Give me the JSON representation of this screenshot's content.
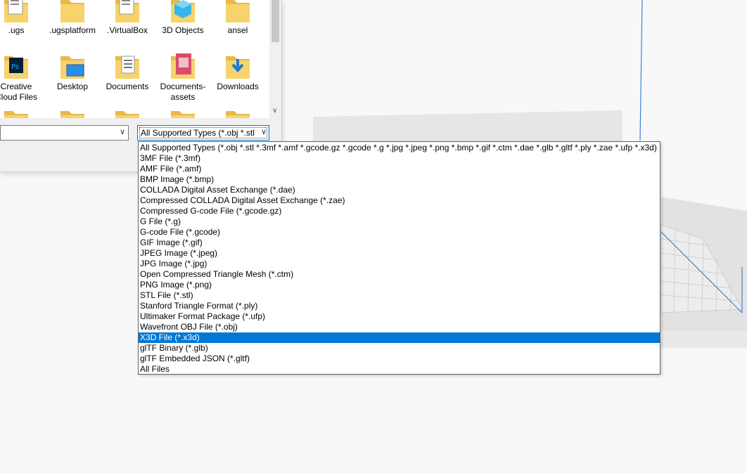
{
  "dialog": {
    "files": [
      {
        "name": ".ugs",
        "icon": "document-folder-icon"
      },
      {
        "name": ".ugsplatform",
        "icon": "folder-icon"
      },
      {
        "name": ".VirtualBox",
        "icon": "document-folder-icon"
      },
      {
        "name": "3D Objects",
        "icon": "3d-objects-folder-icon"
      },
      {
        "name": "ansel",
        "icon": "folder-icon"
      },
      {
        "name": "Creative Cloud Files",
        "icon": "creative-cloud-folder-icon"
      },
      {
        "name": "Desktop",
        "icon": "desktop-folder-icon"
      },
      {
        "name": "Documents",
        "icon": "documents-folder-icon"
      },
      {
        "name": "Documents-assets",
        "icon": "image-folder-icon"
      },
      {
        "name": "Downloads",
        "icon": "downloads-folder-icon"
      }
    ],
    "file_name_value": "",
    "file_type_selected": "All Supported Types (*.obj *.stl *",
    "file_type_options": [
      "All Supported Types (*.obj *.stl *.3mf *.amf *.gcode.gz *.gcode *.g *.jpg *.jpeg *.png *.bmp *.gif *.ctm *.dae *.glb *.gltf *.ply *.zae *.ufp *.x3d)",
      "3MF File (*.3mf)",
      "AMF File (*.amf)",
      "BMP Image (*.bmp)",
      "COLLADA Digital Asset Exchange (*.dae)",
      "Compressed COLLADA Digital Asset Exchange (*.zae)",
      "Compressed G-code File (*.gcode.gz)",
      "G File (*.g)",
      "G-code File (*.gcode)",
      "GIF Image (*.gif)",
      "JPEG Image (*.jpeg)",
      "JPG Image (*.jpg)",
      "Open Compressed Triangle Mesh (*.ctm)",
      "PNG Image (*.png)",
      "STL File (*.stl)",
      "Stanford Triangle Format (*.ply)",
      "Ultimaker Format Package (*.ufp)",
      "Wavefront OBJ File (*.obj)",
      "X3D File (*.x3d)",
      "glTF Binary (*.glb)",
      "glTF Embedded JSON (*.gltf)",
      "All Files"
    ],
    "highlighted_option_index": 18
  },
  "colors": {
    "selection": "#0078d7",
    "folder": "#f6d36b",
    "viewport_bg": "#f8f8f8",
    "build_volume_edge": "#3c82dc"
  }
}
